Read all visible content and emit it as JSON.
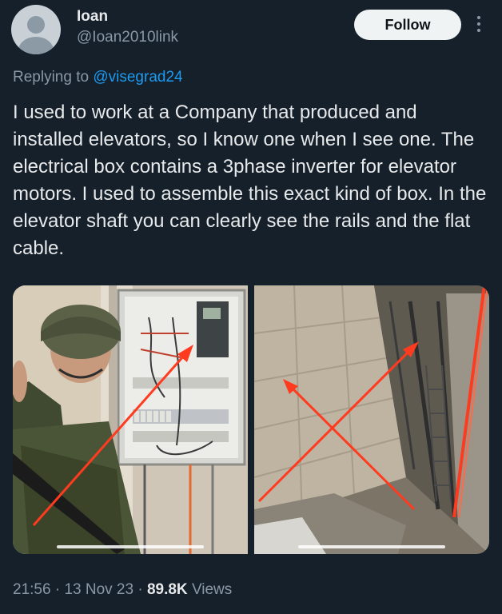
{
  "author": {
    "name": "Ioan",
    "handle": "@Ioan2010link"
  },
  "follow_label": "Follow",
  "reply": {
    "prefix": "Replying to",
    "mention": "@visegrad24"
  },
  "tweet_text": "I used to work at a Company that produced and installed elevators, so I know one when I see one. The electrical box contains a 3phase inverter for elevator motors. I used to assemble this exact kind of box. In the elevator shaft you can clearly see the rails and the flat cable.",
  "media": [
    {
      "subject": "soldier standing beside electrical box with red arrow"
    },
    {
      "subject": "elevator shaft with rails and flat cable with red arrows"
    }
  ],
  "meta": {
    "time": "21:56",
    "date": "13 Nov 23",
    "views_count": "89.8K",
    "views_label": "Views"
  },
  "colors": {
    "background": "#15202b",
    "text": "#e7e9ea",
    "secondary": "#8b98a5",
    "link": "#1d9bf0",
    "annotation_arrow": "#ff3b1f"
  }
}
